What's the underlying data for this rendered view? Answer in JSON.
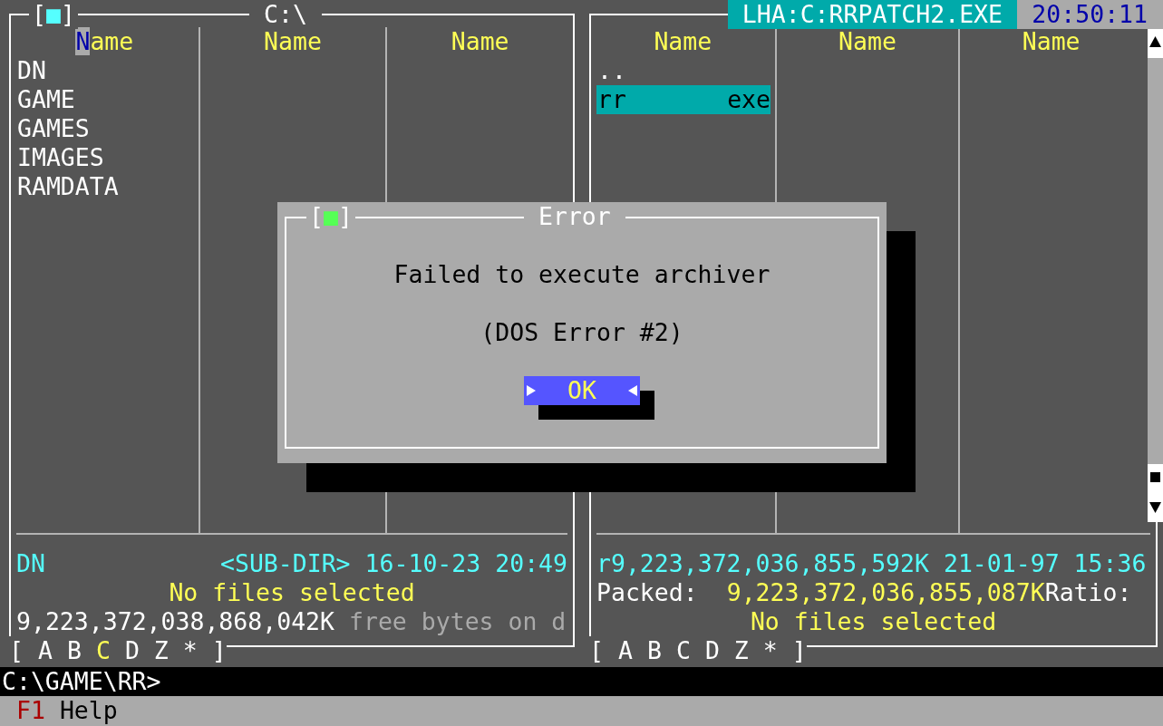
{
  "left_panel": {
    "close_box": "[■]",
    "title": "C:\\",
    "columns": [
      {
        "header": "Name",
        "cursor": true
      },
      {
        "header": "Name",
        "cursor": false
      },
      {
        "header": "Name",
        "cursor": false
      }
    ],
    "files": [
      {
        "name": "DN",
        "selected": false
      },
      {
        "name": "GAME",
        "selected": false
      },
      {
        "name": "GAMES",
        "selected": false
      },
      {
        "name": "IMAGES",
        "selected": false
      },
      {
        "name": "RAMDATA",
        "selected": false
      }
    ],
    "info": {
      "name": "DN",
      "size": "<SUB-DIR>",
      "date": "16-10-23",
      "time": "20:49",
      "selection": "No files selected",
      "free_space": "9,223,372,038,868,042K",
      "free_label": "free bytes on d"
    },
    "drive_bar": {
      "open": "[",
      "close": "]",
      "drives": [
        {
          "label": "A",
          "selected": false
        },
        {
          "label": "B",
          "selected": false
        },
        {
          "label": "C",
          "selected": true
        },
        {
          "label": "D",
          "selected": false
        },
        {
          "label": "Z",
          "selected": false
        },
        {
          "label": "*",
          "selected": false
        }
      ]
    }
  },
  "right_panel": {
    "archive_title": "LHA:C:RRPATCH2.EXE",
    "clock": "20:50:11",
    "columns": [
      {
        "header": "Name",
        "cursor": false
      },
      {
        "header": "Name",
        "cursor": false
      },
      {
        "header": "Name",
        "cursor": false
      }
    ],
    "files": [
      {
        "name": "..",
        "selected": false
      },
      {
        "name": "rr",
        "ext": "exe",
        "selected": true
      }
    ],
    "info": {
      "size_line": "r9,223,372,036,855,592K",
      "date": "21-01-97",
      "time": "15:36",
      "packed_label": "Packed:",
      "packed_value": "9,223,372,036,855,087K",
      "ratio_label": "Ratio:",
      "selection": "No files selected"
    },
    "drive_bar": {
      "open": "[",
      "close": "]",
      "drives": [
        {
          "label": "A",
          "selected": false
        },
        {
          "label": "B",
          "selected": false
        },
        {
          "label": "C",
          "selected": false
        },
        {
          "label": "D",
          "selected": false
        },
        {
          "label": "Z",
          "selected": false
        },
        {
          "label": "*",
          "selected": false
        }
      ]
    }
  },
  "dialog": {
    "close_box": "[■]",
    "title": "Error",
    "message": "Failed to execute archiver",
    "detail": "(DOS Error #2)",
    "button": "OK"
  },
  "command_line": "C:\\GAME\\RR>",
  "status_bar": [
    {
      "key": "F1",
      "label": "Help"
    }
  ]
}
